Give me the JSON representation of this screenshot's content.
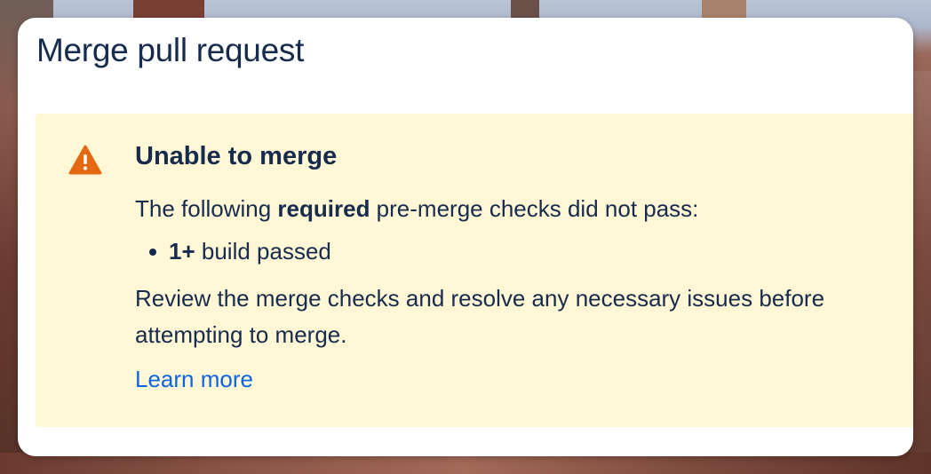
{
  "modal": {
    "title": "Merge pull request"
  },
  "warning": {
    "icon": "warning-triangle-icon",
    "icon_color": "#e56910",
    "background": "#fff7d6",
    "title": "Unable to merge",
    "intro_before": "The following ",
    "intro_bold": "required",
    "intro_after": " pre-merge checks did not pass:",
    "checks": [
      {
        "bold": "1+",
        "text": " build passed"
      }
    ],
    "review_text": "Review the merge checks and resolve any necessary issues before attempting to merge.",
    "learn_more": "Learn more",
    "link_color": "#0c66e4"
  }
}
